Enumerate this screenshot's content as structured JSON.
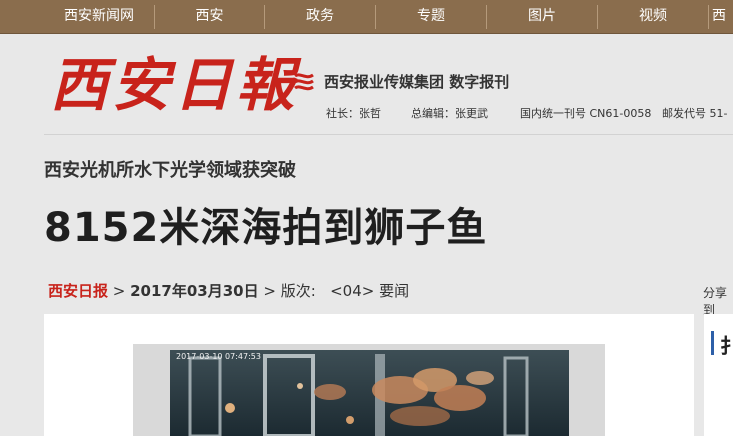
{
  "nav": {
    "items": [
      "西安新闻网",
      "西安",
      "政务",
      "专题",
      "图片",
      "视频",
      "西"
    ]
  },
  "header": {
    "logo_text": "西安日報",
    "group_name": "西安报业传媒集团 数字报刊",
    "president": "社长：张哲",
    "chief_editor": "总编辑：张更武",
    "domestic_code": "国内统一刊号 CN61-0058",
    "postal_code": "邮发代号 51-"
  },
  "article": {
    "subtitle": "西安光机所水下光学领域获突破",
    "title": "8152米深海拍到狮子鱼",
    "breadcrumb": {
      "paper": "西安日报",
      "sep1": " > ",
      "date": "2017年03月30日",
      "sep2": " > ",
      "edition_label": "版次:",
      "edition": "<04>",
      "section": "要闻"
    },
    "share": "分享到"
  },
  "photo": {
    "timestamp": "2017-03-10  07:47:53"
  },
  "sidebar": {
    "glyph": "扌"
  },
  "colors": {
    "nav_bg": "#8a6d4d",
    "brand_red": "#c8231b",
    "accent_blue": "#2d5fa8"
  }
}
